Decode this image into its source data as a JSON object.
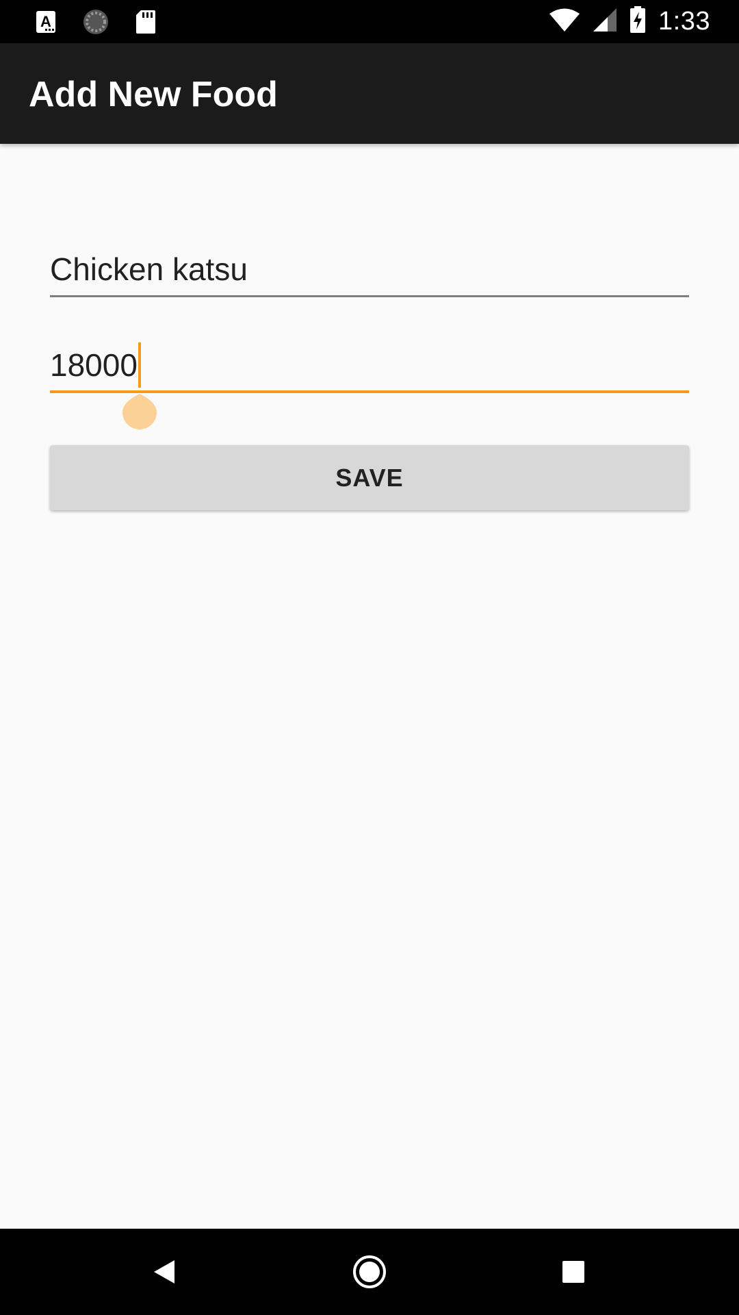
{
  "status_bar": {
    "time": "1:33",
    "icons": [
      "font-a-notification-icon",
      "loading-spinner-icon",
      "sd-card-icon",
      "wifi-icon",
      "cellular-signal-icon",
      "battery-charging-icon"
    ]
  },
  "app_bar": {
    "title": "Add New Food"
  },
  "form": {
    "food_name_value": "Chicken katsu",
    "price_value": "18000",
    "save_label": "SAVE"
  },
  "nav_bar": {
    "icons": [
      "back-icon",
      "home-icon",
      "recents-icon"
    ]
  },
  "colors": {
    "accent": "#f59b1c",
    "app_bar": "#1b1b1b",
    "background": "#fafafa",
    "button": "#d8d8d8"
  }
}
